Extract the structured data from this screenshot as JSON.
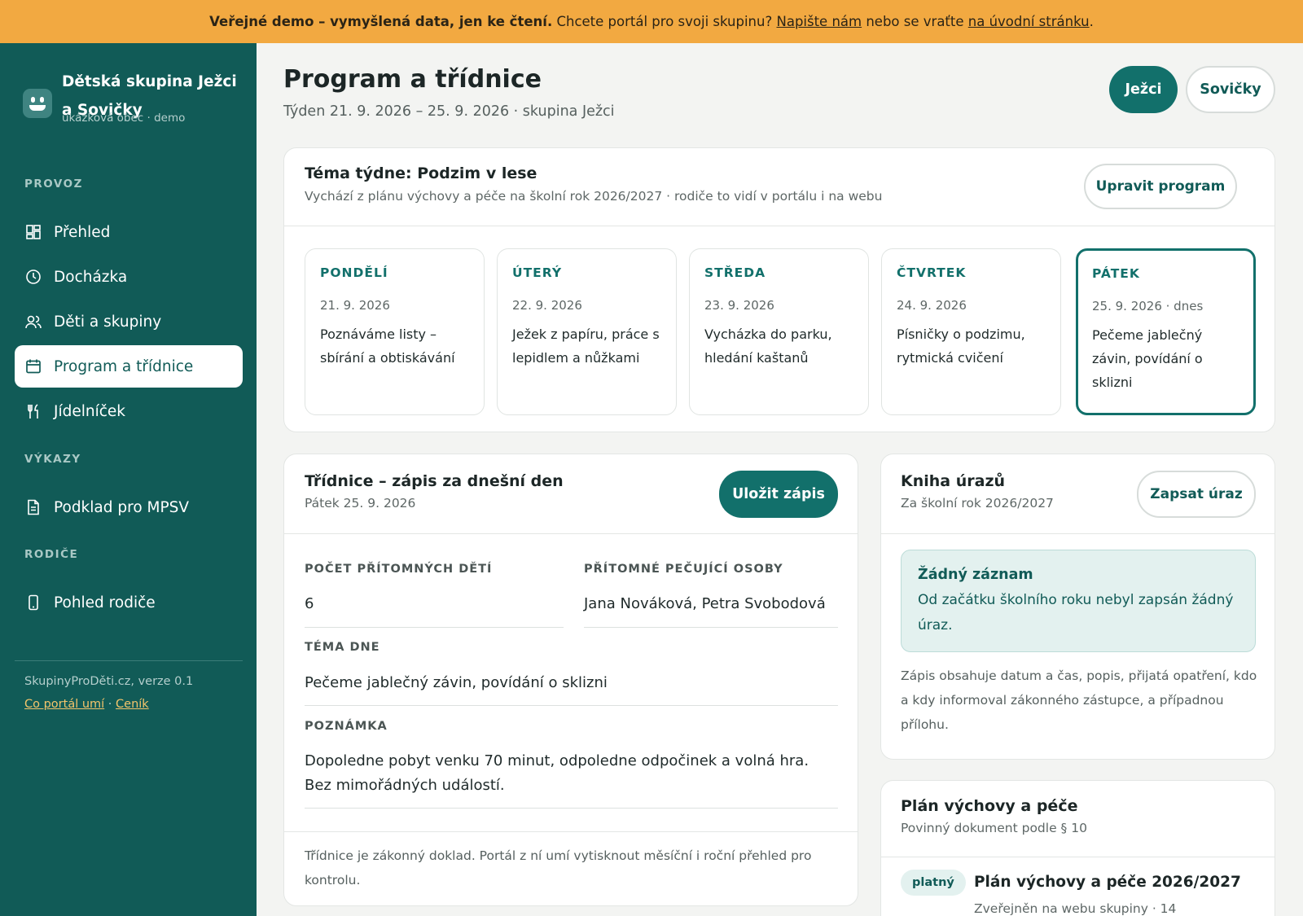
{
  "banner": {
    "lead": "Veřejné demo – vymyšlená data, jen ke čtení.",
    "middle": " Chcete portál pro svoji skupinu? ",
    "link1": "Napište nám",
    "between": " nebo se vraťte ",
    "link2": "na úvodní stránku",
    "end": "."
  },
  "sidebar": {
    "brand_name": "Dětská skupina Ježci a Sovičky",
    "brand_sub": "ukázková obec · demo",
    "sections": {
      "provoz": "PROVOZ",
      "vykazy": "VÝKAZY",
      "rodice": "RODIČE"
    },
    "items": [
      {
        "label": "Přehled",
        "icon": "dashboard-icon"
      },
      {
        "label": "Docházka",
        "icon": "clock-icon"
      },
      {
        "label": "Děti a skupiny",
        "icon": "users-icon"
      },
      {
        "label": "Program a třídnice",
        "icon": "calendar-icon",
        "active": true
      },
      {
        "label": "Jídelníček",
        "icon": "cutlery-icon"
      },
      {
        "label": "Podklad pro MPSV",
        "icon": "document-icon"
      },
      {
        "label": "Pohled rodiče",
        "icon": "phone-icon"
      }
    ],
    "version": "SkupinyProDěti.cz, verze 0.1",
    "link_features": "Co portál umí",
    "link_separator": " · ",
    "link_pricing": "Ceník"
  },
  "header": {
    "title": "Program a třídnice",
    "subtitle": "Týden 21. 9. 2026 – 25. 9. 2026 · skupina Ježci",
    "group_active": "Ježci",
    "group_other": "Sovičky"
  },
  "theme": {
    "title": "Téma týdne: Podzim v lese",
    "subtitle": "Vychází z plánu výchovy a péče na školní rok 2026/2027 · rodiče to vidí v portálu i na webu",
    "edit_button": "Upravit program",
    "days": [
      {
        "name": "PONDĚLÍ",
        "date": "21. 9. 2026",
        "text": "Poznáváme listy – sbírání a obtiskávání"
      },
      {
        "name": "ÚTERÝ",
        "date": "22. 9. 2026",
        "text": "Ježek z papíru, práce s lepidlem a nůžkami"
      },
      {
        "name": "STŘEDA",
        "date": "23. 9. 2026",
        "text": "Vycházka do parku, hledání kaštanů"
      },
      {
        "name": "ČTVRTEK",
        "date": "24. 9. 2026",
        "text": "Písničky o podzimu, rytmická cvičení"
      },
      {
        "name": "PÁTEK",
        "date": "25. 9. 2026 · dnes",
        "text": "Pečeme jablečný závin, povídání o sklizni",
        "today": true
      }
    ]
  },
  "tridnice": {
    "title": "Třídnice – zápis za dnešní den",
    "subtitle": "Pátek 25. 9. 2026",
    "save_button": "Uložit zápis",
    "children_label": "POČET PŘÍTOMNÝCH DĚTÍ",
    "children_value": "6",
    "carers_label": "PŘÍTOMNÉ PEČUJÍCÍ OSOBY",
    "carers_value": "Jana Nováková, Petra Svobodová",
    "topic_label": "TÉMA DNE",
    "topic_value": "Pečeme jablečný závin, povídání o sklizni",
    "note_label": "POZNÁMKA",
    "note_value": "Dopoledne pobyt venku 70 minut, odpoledne odpočinek a volná hra. Bez mimořádných událostí.",
    "footer": "Třídnice je zákonný doklad. Portál z ní umí vytisknout měsíční i roční přehled pro kontrolu."
  },
  "injuries": {
    "title": "Kniha úrazů",
    "subtitle": "Za školní rok 2026/2027",
    "button": "Zapsat úraz",
    "empty_title": "Žádný záznam",
    "empty_text": "Od začátku školního roku nebyl zapsán žádný úraz.",
    "note": "Zápis obsahuje datum a čas, popis, přijatá opatření, kdo a kdy informoval zákonného zástupce, a případnou přílohu."
  },
  "plan": {
    "title": "Plán výchovy a péče",
    "subtitle": "Povinný dokument podle § 10",
    "badge": "platný",
    "doc_title": "Plán výchovy a péče 2026/2027",
    "doc_sub": "Zveřejněn na webu skupiny · 14"
  },
  "colors": {
    "banner": "#f2a941",
    "sidebar": "#115b57",
    "accent": "#12706b"
  }
}
